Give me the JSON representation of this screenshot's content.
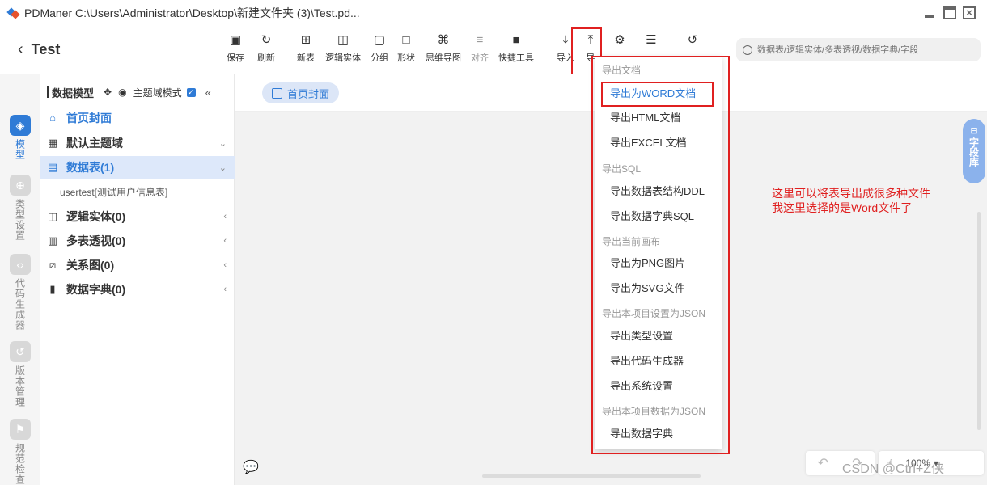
{
  "window": {
    "title": "PDManer  C:\\Users\\Administrator\\Desktop\\新建文件夹 (3)\\Test.pd..."
  },
  "project": {
    "name": "Test"
  },
  "toolbar": {
    "save": "保存",
    "refresh": "刷新",
    "new_table": "新表",
    "logic_entity": "逻辑实体",
    "group": "分组",
    "shape": "形状",
    "mindmap": "思维导图",
    "align": "对齐",
    "quick_tools": "快捷工具",
    "import": "导入",
    "export": "导"
  },
  "search": {
    "placeholder": "数据表/逻辑实体/多表透视/数据字典/字段"
  },
  "leftnav": {
    "model": "模型",
    "type_settings": "类型设置",
    "codegen": "代码生成器",
    "version": "版本管理",
    "norm_check": "规范检查"
  },
  "tree": {
    "title": "数据模型",
    "mode_label": "主题域模式",
    "home": "首页封面",
    "default_domain": "默认主题域",
    "tables": "数据表(1)",
    "table_item": "usertest[测试用户信息表]",
    "logic_entities": "逻辑实体(0)",
    "multi_pivot": "多表透视(0)",
    "relation": "关系图(0)",
    "dictionary": "数据字典(0)"
  },
  "main": {
    "tab": "首页封面",
    "field_library": "字段库",
    "annotation_line1": "这里可以将表导出成很多种文件",
    "annotation_line2": "我这里选择的是Word文件了",
    "zoom": "100%",
    "watermark": "CSDN @Ctrl+Z侠"
  },
  "export_menu": {
    "group_doc": "导出文档",
    "word": "导出为WORD文档",
    "html": "导出HTML文档",
    "excel": "导出EXCEL文档",
    "group_sql": "导出SQL",
    "ddl": "导出数据表结构DDL",
    "dict_sql": "导出数据字典SQL",
    "group_canvas": "导出当前画布",
    "png": "导出为PNG图片",
    "svg": "导出为SVG文件",
    "group_settings_json": "导出本项目设置为JSON",
    "type_settings": "导出类型设置",
    "codegen": "导出代码生成器",
    "system_settings": "导出系统设置",
    "group_data_json": "导出本项目数据为JSON",
    "data_dict": "导出数据字典"
  },
  "colors": {
    "accent": "#2f7bd6",
    "highlight": "#e02020",
    "selected_bg": "#dde8fa"
  }
}
